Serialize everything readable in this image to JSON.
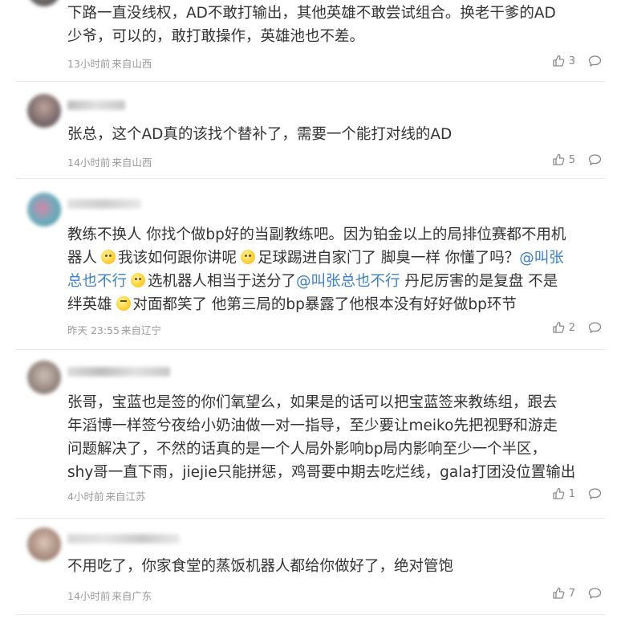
{
  "comments": [
    {
      "lines": [
        [
          {
            "t": "下路一直没线权，AD不敢打输出，其他英雄不敢尝试组合。换老干爹的AD"
          }
        ],
        [
          {
            "t": "少爷，可以的，敢打敢操作，英雄池也不差。"
          }
        ]
      ],
      "time": "13小时前",
      "source": "来自山西",
      "likes": "3"
    },
    {
      "lines": [
        [
          {
            "t": "张总，这个AD真的该找个替补了，需要一个能打对线的AD"
          }
        ]
      ],
      "time": "14小时前",
      "source": "来自山西",
      "likes": "5"
    },
    {
      "lines": [
        [
          {
            "t": "教练不换人 你找个做bp好的当副教练吧。因为铂金以上的局排位赛都不用机"
          }
        ],
        [
          {
            "t": "器人"
          },
          {
            "emoji": "smile"
          },
          {
            "t": "我该如何跟你讲呢"
          },
          {
            "emoji": "smile"
          },
          {
            "t": "足球踢进自家门了 脚臭一样 你懂了吗？"
          },
          {
            "m": "@叫张"
          }
        ],
        [
          {
            "m": "总也不行"
          },
          {
            "emoji": "smile"
          },
          {
            "t": "选机器人相当于送分了"
          },
          {
            "m": "@叫张总也不行"
          },
          {
            "t": " 丹尼厉害的是复盘 不是"
          }
        ],
        [
          {
            "t": "绊英雄"
          },
          {
            "emoji": "laugh"
          },
          {
            "t": "对面都笑了 他第三局的bp暴露了他根本没有好好做bp环节"
          }
        ]
      ],
      "time": "昨天 23:55",
      "source": "来自辽宁",
      "likes": "2"
    },
    {
      "lines": [
        [
          {
            "t": "张哥，宝蓝也是签的你们氧望么，如果是的话可以把宝蓝签来教练组，跟去"
          }
        ],
        [
          {
            "t": "年滔博一样签兮夜给小奶油做一对一指导，至少要让meiko先把视野和游走"
          }
        ],
        [
          {
            "t": "问题解决了，不然的话真的是一个人局外影响bp局内影响至少一个半区，"
          }
        ],
        [
          {
            "t": "shy哥一直下雨，jiejie只能拼惩，鸡哥要中期去吃烂线，gala打团没位置输出"
          }
        ]
      ],
      "time": "4小时前",
      "source": "来自江苏",
      "likes": "1"
    },
    {
      "lines": [
        [
          {
            "t": "不用吃了，你家食堂的蒸饭机器人都给你做好了，绝对管饱"
          }
        ]
      ],
      "time": "14小时前",
      "source": "来自广东",
      "likes": "7"
    }
  ],
  "colors": {
    "text": "#333333",
    "meta": "#9a9a9a",
    "mention": "#3b82c4",
    "divider": "#e7e7e7"
  },
  "icons": {
    "like": "thumbs-up-icon",
    "reply": "speech-bubble-icon",
    "emoji": "smile-emoji-icon"
  }
}
